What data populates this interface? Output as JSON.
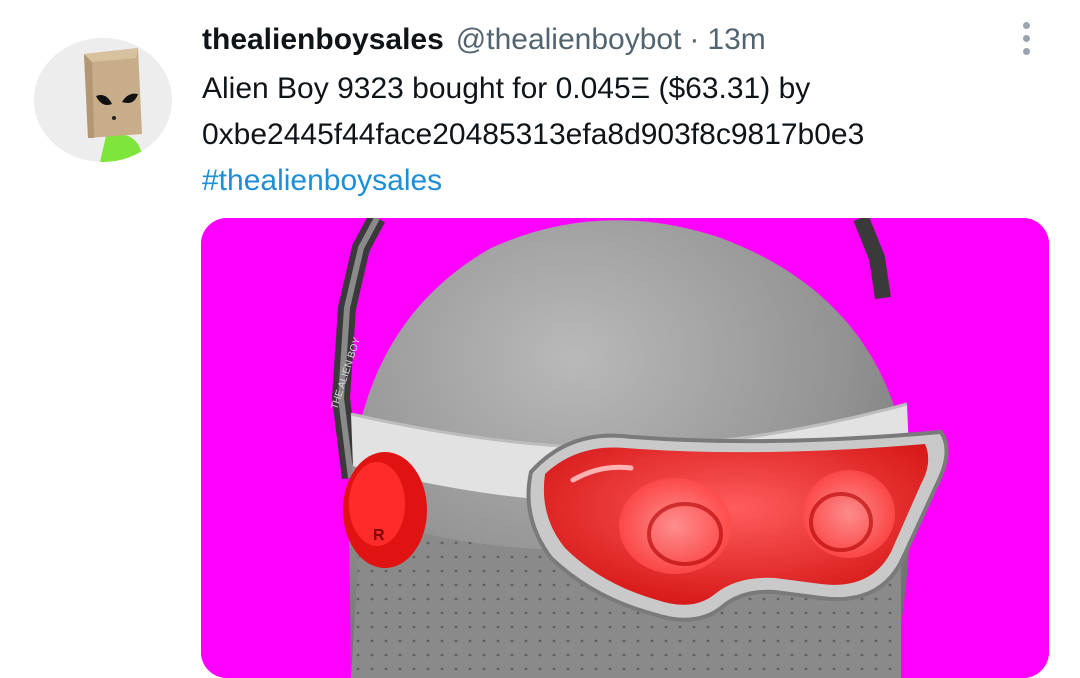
{
  "tweet": {
    "display_name": "thealienboysales",
    "handle": "@thealienboybot",
    "separator": "·",
    "time": "13m",
    "text_line1": "Alien Boy 9323 bought for 0.045Ξ ($63.31) by",
    "text_line2": "0xbe2445f44face20485313efa8d903f8c9817b0e3",
    "hashtag": "#thealienboysales"
  },
  "avatar": {
    "icon": "paper-bag-alien-avatar"
  },
  "menu": {
    "icon": "more-options-vertical-dots-icon"
  },
  "media": {
    "icon": "alien-boy-helmet-image",
    "headphone_letter": "R",
    "helmet_text": "THE ALIEN BOY"
  },
  "colors": {
    "text": "#0f1419",
    "secondary": "#536471",
    "link": "#1d8fd8",
    "media_background": "#ff00ff",
    "visor": "#ff3b3b"
  }
}
